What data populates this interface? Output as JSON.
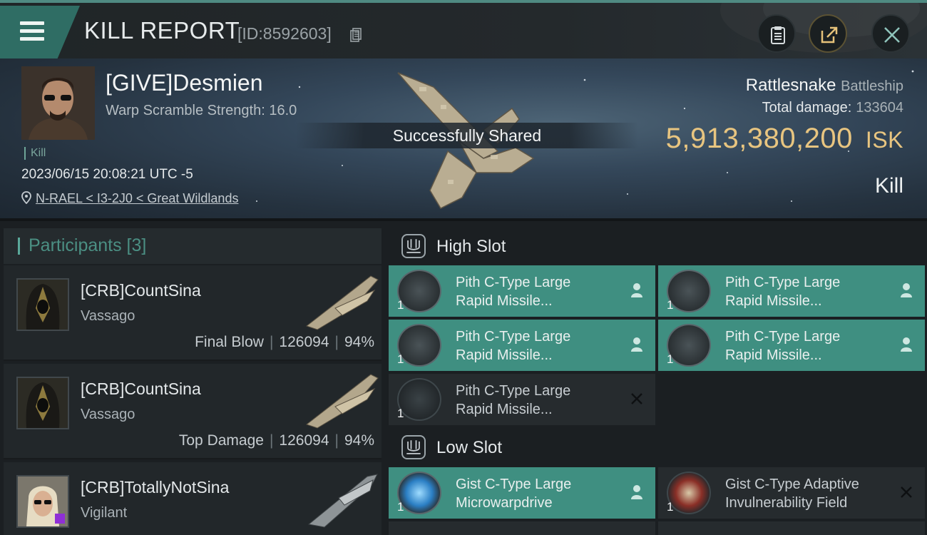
{
  "header": {
    "title": "KILL REPORT",
    "report_id": "[ID:8592603]",
    "buttons": [
      "clipboard-icon",
      "share-icon",
      "close-icon"
    ]
  },
  "victim": {
    "name": "[GIVE]Desmien",
    "warp_scramble": "Warp Scramble Strength: 16.0",
    "tag": "Kill",
    "timestamp": "2023/06/15 20:08:21 UTC -5",
    "location": "N-RAEL < I3-2J0 < Great Wildlands",
    "ship_name": "Rattlesnake",
    "ship_class": "Battleship",
    "total_damage_label": "Total damage:",
    "total_damage": "133604",
    "isk_value": "5,913,380,200",
    "isk_unit": "ISK",
    "result": "Kill"
  },
  "toast": "Successfully Shared",
  "participants": {
    "title": "Participants [3]",
    "items": [
      {
        "name": "[CRB]CountSina",
        "ship": "Vassago",
        "role": "Final Blow",
        "damage": "126094",
        "percent": "94%"
      },
      {
        "name": "[CRB]CountSina",
        "ship": "Vassago",
        "role": "Top Damage",
        "damage": "126094",
        "percent": "94%"
      },
      {
        "name": "[CRB]TotallyNotSina",
        "ship": "Vigilant"
      }
    ]
  },
  "high_slot": {
    "title": "High Slot",
    "modules": [
      {
        "line1": "Pith C-Type Large",
        "line2": "Rapid Missile...",
        "qty": "1",
        "state": "dropped"
      },
      {
        "line1": "Pith C-Type Large",
        "line2": "Rapid Missile...",
        "qty": "1",
        "state": "dropped"
      },
      {
        "line1": "Pith C-Type Large",
        "line2": "Rapid Missile...",
        "qty": "1",
        "state": "dropped"
      },
      {
        "line1": "Pith C-Type Large",
        "line2": "Rapid Missile...",
        "qty": "1",
        "state": "dropped"
      },
      {
        "line1": "Pith C-Type Large",
        "line2": "Rapid Missile...",
        "qty": "1",
        "state": "destroyed"
      }
    ]
  },
  "low_slot": {
    "title": "Low Slot",
    "modules": [
      {
        "line1": "Gist C-Type Large",
        "line2": "Microwarpdrive",
        "qty": "1",
        "state": "dropped"
      },
      {
        "line1": "Gist C-Type Adaptive",
        "line2": "Invulnerability Field",
        "qty": "1",
        "state": "destroyed"
      }
    ]
  },
  "colors": {
    "accent_teal": "#3f8f81",
    "isk_gold": "#e8c580",
    "background": "#1b1f22"
  }
}
